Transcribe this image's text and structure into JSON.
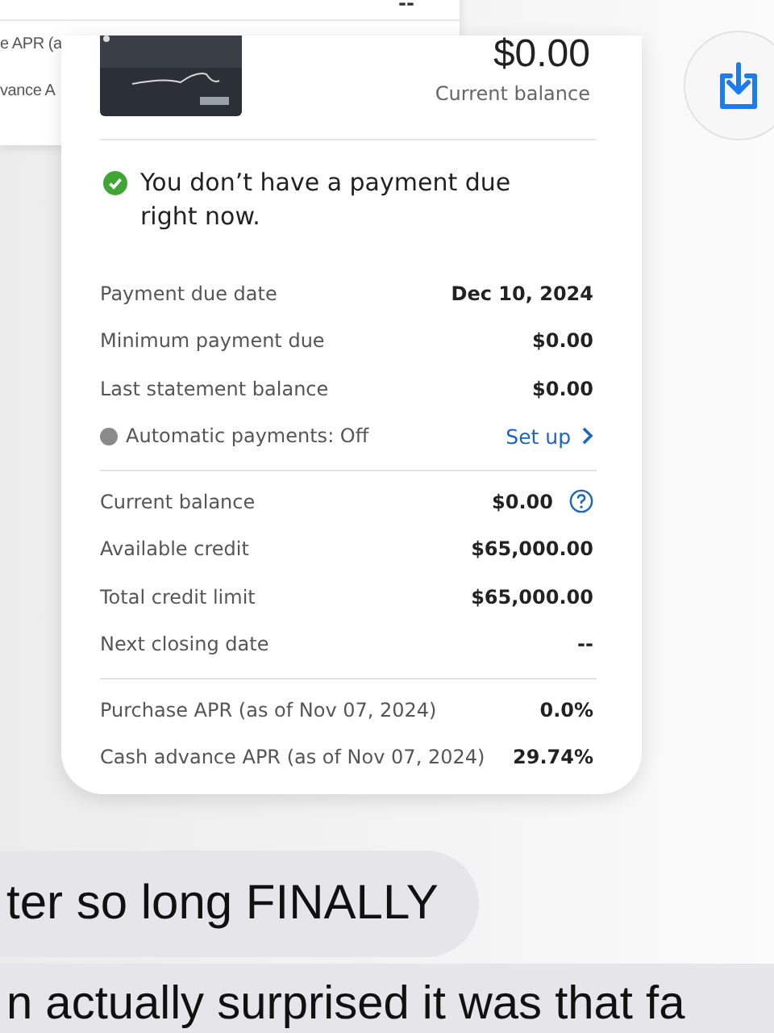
{
  "background_card": {
    "rows": [
      {
        "value": "--"
      },
      {
        "label": "e APR (a"
      },
      {
        "label": "vance A"
      }
    ]
  },
  "account_card": {
    "card_image": {
      "kind": "picture"
    },
    "balance": "$0.00",
    "balance_label": "Current balance",
    "notice": {
      "ok": true,
      "text": "You don’t have a payment due right now."
    },
    "sections": [
      [
        {
          "label": "Payment due date",
          "value": "Dec 10, 2024"
        },
        {
          "label": "Minimum payment due",
          "value": "$0.00"
        },
        {
          "label": "Last statement balance",
          "value": "$0.00"
        },
        {
          "label": "Automatic payments: Off",
          "kind": "autopay",
          "on": false,
          "action": "Set up"
        }
      ],
      [
        {
          "label": "Current balance",
          "value": "$0.00",
          "kind": "help"
        },
        {
          "label": "Available credit",
          "value": "$65,000.00"
        },
        {
          "label": "Total credit limit",
          "value": "$65,000.00"
        },
        {
          "label": "Next closing date",
          "value": "--"
        }
      ],
      [
        {
          "label": "Purchase APR (as of Nov 07, 2024)",
          "value": "0.0%"
        },
        {
          "label": "Cash advance APR (as of Nov 07, 2024)",
          "value": "29.74%"
        }
      ]
    ]
  },
  "messages": [
    {
      "text": "ter so long FINALLY"
    },
    {
      "text": "n actually surprised it was that fa"
    }
  ]
}
